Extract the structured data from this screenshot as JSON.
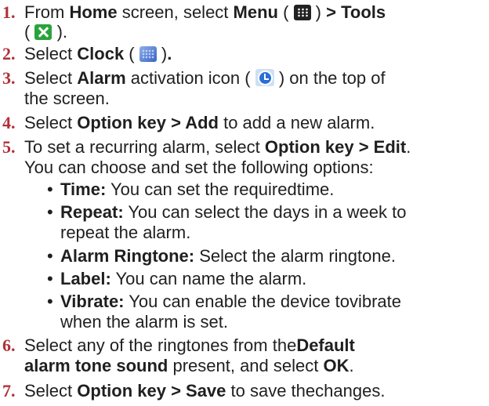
{
  "icons": {
    "menu": "menu-grid-icon",
    "tools": "tools-icon",
    "clock": "clock-icon",
    "alarm": "alarm-clock-icon"
  },
  "colors": {
    "step_number": "#b0303a",
    "text": "#1f1f1f"
  },
  "steps": [
    {
      "number": "1.",
      "l1_a": "From ",
      "l1_b": "Home",
      "l1_c": " screen, select ",
      "l1_d": "Menu",
      "l1_e": " ( ",
      "l1_f": " ) ",
      "l1_g": "> Tools",
      "l2_a": "( ",
      "l2_b": " )."
    },
    {
      "number": "2.",
      "a": "Select ",
      "b": "Clock",
      "c": " ( ",
      "d": " )",
      "e": "."
    },
    {
      "number": "3.",
      "a": "Select ",
      "b": "Alarm",
      "c": " activation icon ( ",
      "d": " ) on the top of",
      "l2": "the screen."
    },
    {
      "number": "4.",
      "a": "Select ",
      "b": "Option key > Add",
      "c": " to add a new alarm."
    },
    {
      "number": "5.",
      "a": "To set a recurring alarm, select ",
      "b": "Option key > Edit",
      "c": ".",
      "l2": "You can choose and set the following options:",
      "bullets": [
        {
          "label": "Time:",
          "text": " You can set the requiredtime.",
          "text2": ""
        },
        {
          "label": "Repeat:",
          "text": " You can select the days in a week to",
          "text2": "repeat the alarm."
        },
        {
          "label": "Alarm Ringtone:",
          "text": " Select the alarm ringtone.",
          "text2": ""
        },
        {
          "label": "Label:",
          "text": " You can name the alarm.",
          "text2": ""
        },
        {
          "label": "Vibrate:",
          "text": " You can enable the device tovibrate",
          "text2": "when the alarm is set."
        }
      ]
    },
    {
      "number": "6.",
      "a": "Select any of the ringtones from the",
      "b": "Default",
      "l2b": "alarm tone sound",
      "l2c": " present, and select ",
      "l2d": "OK",
      "l2e": "."
    },
    {
      "number": "7.",
      "a": "Select ",
      "b": "Option key > Save",
      "c": " to save thechanges."
    }
  ],
  "bullet_char": "•"
}
